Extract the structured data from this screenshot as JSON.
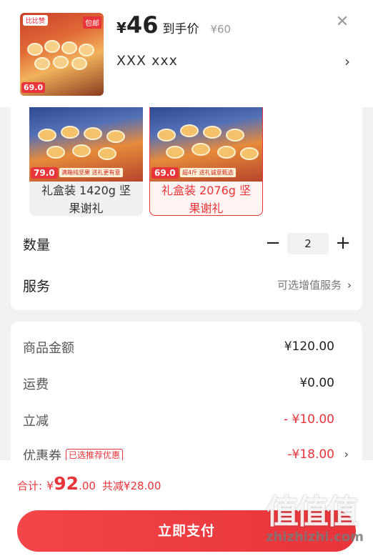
{
  "header": {
    "thumb": {
      "brand": "比比赞",
      "mail_tag": "包邮",
      "price_tag": "69.0"
    },
    "currency": "¥",
    "price": "46",
    "price_suffix": "到手价",
    "original_price": "¥60",
    "close_icon": "close-icon",
    "spec_text": "XXX  xxx",
    "chevron": "›"
  },
  "options": [
    {
      "label": "礼盒装 1420g 坚果谢礼",
      "price_tag": "79.0",
      "promo": "满箱纯坚果 送礼更有意",
      "selected": false
    },
    {
      "label": "礼盒装 2076g 坚果谢礼",
      "price_tag": "69.0",
      "promo": "超4斤 送礼诚意甄选",
      "selected": true
    }
  ],
  "quantity": {
    "label": "数量",
    "minus": "−",
    "value": "2",
    "plus": "+"
  },
  "service": {
    "label": "服务",
    "value": "可选增值服务",
    "chevron": "›"
  },
  "details": {
    "goods": {
      "label": "商品金额",
      "value": "¥120.00"
    },
    "shipping": {
      "label": "运费",
      "value": "¥0.00"
    },
    "discount": {
      "label": "立减",
      "value": "- ¥10.00"
    },
    "coupon": {
      "label": "优惠券",
      "tag": "已选推荐优惠",
      "value": "-¥18.00",
      "chevron": "›"
    }
  },
  "footer": {
    "total_label": "合计:",
    "total_yen": "¥",
    "total_int": "92",
    "total_dec": ".00",
    "saved": "共减¥28.00",
    "pay_label": "立即支付"
  },
  "watermark": {
    "logo": "值值值",
    "url": "zhizhizhi.com"
  },
  "colors": {
    "accent": "#e8343a",
    "background": "#f2f2f2"
  }
}
